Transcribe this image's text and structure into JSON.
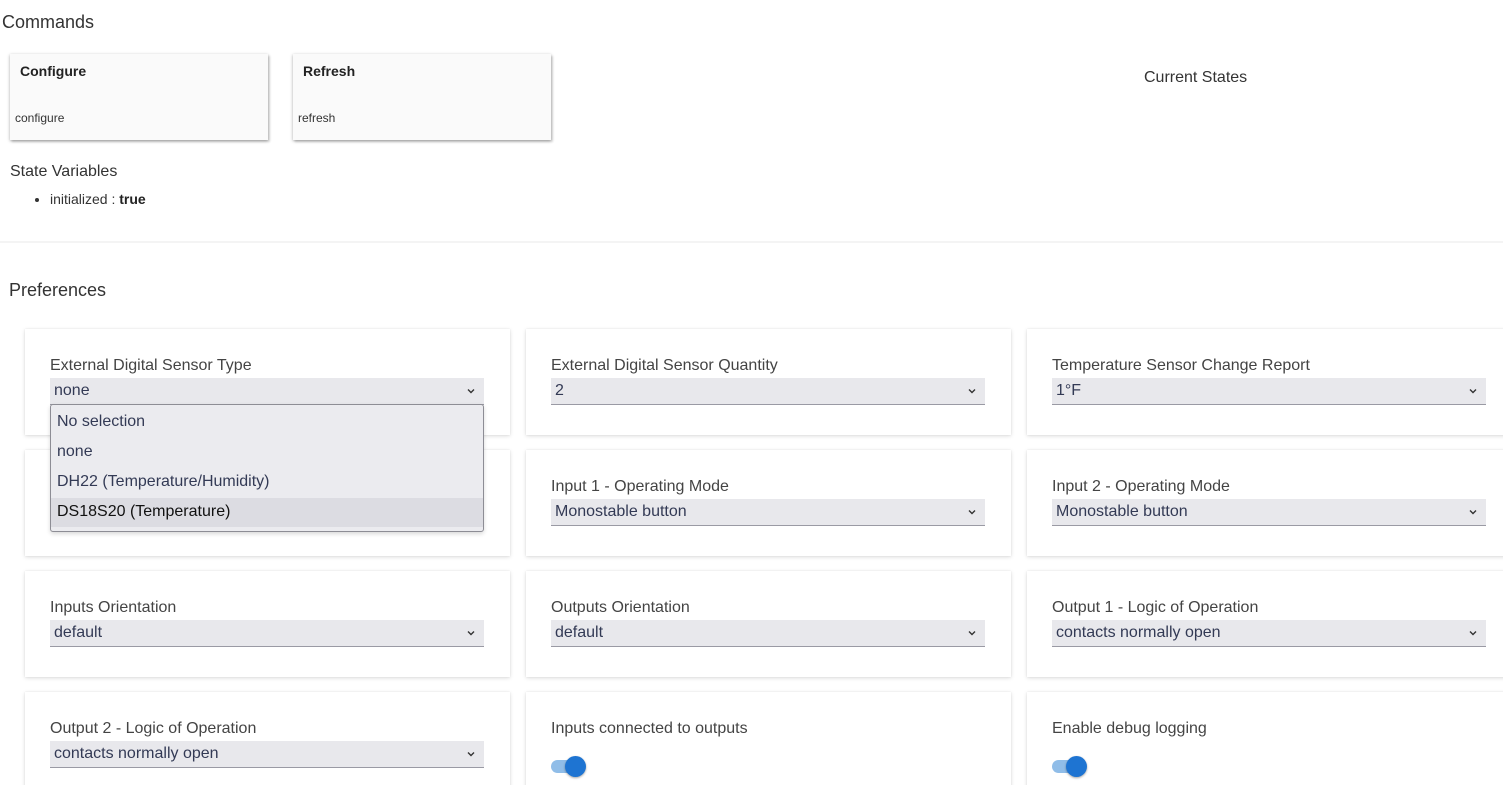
{
  "commands": {
    "title": "Commands",
    "items": [
      {
        "label": "Configure",
        "sub": "configure"
      },
      {
        "label": "Refresh",
        "sub": "refresh"
      }
    ]
  },
  "current_states": {
    "title": "Current States"
  },
  "state_variables": {
    "title": "State Variables",
    "items": [
      {
        "key": "initialized",
        "sep": " : ",
        "value": "true"
      }
    ]
  },
  "preferences": {
    "title": "Preferences",
    "items": [
      {
        "label": "External Digital Sensor Type",
        "value": "none"
      },
      {
        "label": "External Digital Sensor Quantity",
        "value": "2"
      },
      {
        "label": "Temperature Sensor Change Report",
        "value": "1°F"
      },
      {
        "label": "",
        "value": ""
      },
      {
        "label": "Input 1 - Operating Mode",
        "value": "Monostable button"
      },
      {
        "label": "Input 2 - Operating Mode",
        "value": "Monostable button"
      },
      {
        "label": "Inputs Orientation",
        "value": "default"
      },
      {
        "label": "Outputs Orientation",
        "value": "default"
      },
      {
        "label": "Output 1 - Logic of Operation",
        "value": "contacts normally open"
      },
      {
        "label": "Output 2 - Logic of Operation",
        "value": "contacts normally open"
      },
      {
        "label": "Inputs connected to outputs",
        "toggle_on": true
      },
      {
        "label": "Enable debug logging",
        "toggle_on": true
      }
    ]
  },
  "dropdown": {
    "options": [
      "No selection",
      "none",
      "DH22 (Temperature/Humidity)",
      "DS18S20 (Temperature)"
    ],
    "highlighted_index": 3
  },
  "colors": {
    "toggle_knob": "#1e74d2",
    "toggle_track": "#90bde8",
    "select_bg": "#e8e8ec"
  }
}
